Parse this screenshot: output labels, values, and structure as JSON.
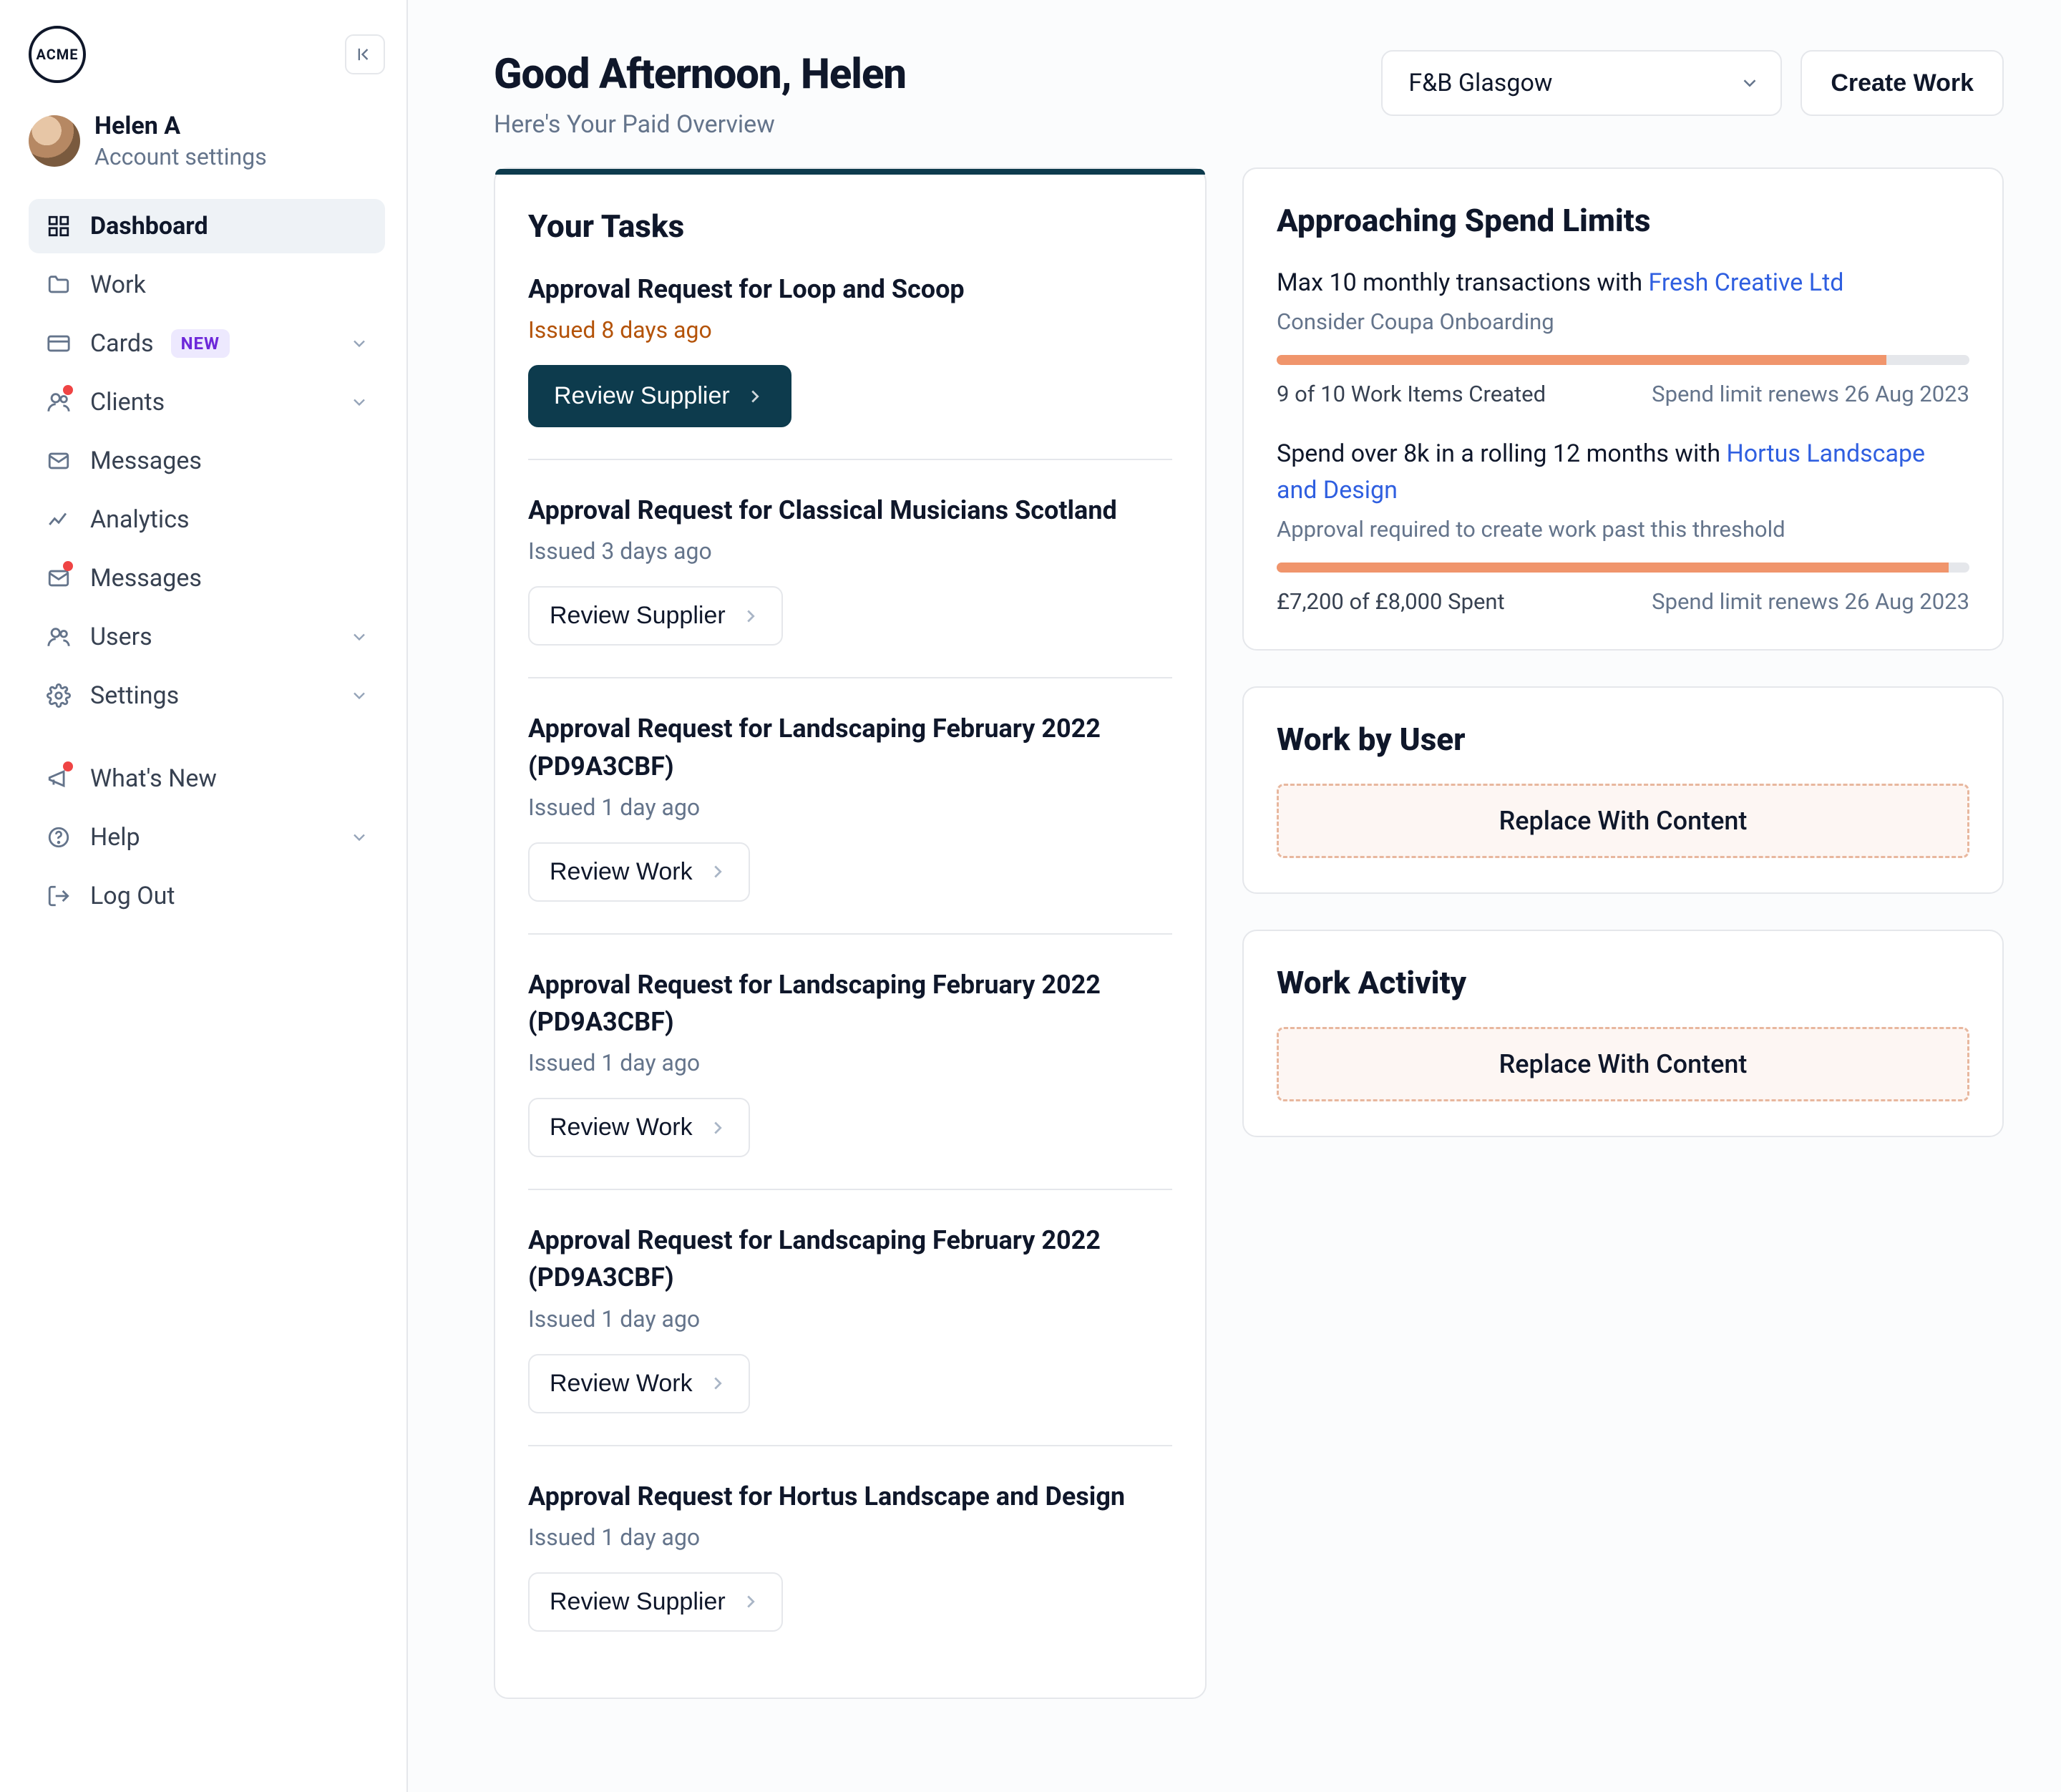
{
  "brand": "ACME",
  "user": {
    "name": "Helen A",
    "subtitle": "Account settings"
  },
  "sidebar": {
    "items": [
      {
        "label": "Dashboard"
      },
      {
        "label": "Work"
      },
      {
        "label": "Cards",
        "badge": "NEW"
      },
      {
        "label": "Clients"
      },
      {
        "label": "Messages"
      },
      {
        "label": "Analytics"
      },
      {
        "label": "Messages"
      },
      {
        "label": "Users"
      },
      {
        "label": "Settings"
      }
    ],
    "footer": [
      {
        "label": "What's New"
      },
      {
        "label": "Help"
      },
      {
        "label": "Log Out"
      }
    ]
  },
  "header": {
    "greeting": "Good Afternoon, Helen",
    "subtitle": "Here's Your Paid Overview",
    "select_value": "F&B Glasgow",
    "create_label": "Create Work"
  },
  "tasks": {
    "title": "Your Tasks",
    "items": [
      {
        "title": "Approval Request for Loop and Scoop",
        "meta": "Issued 8 days ago",
        "warn": true,
        "action": "Review Supplier",
        "primary": true
      },
      {
        "title": "Approval Request for Classical Musicians Scotland",
        "meta": "Issued 3 days ago",
        "warn": false,
        "action": "Review Supplier",
        "primary": false
      },
      {
        "title": "Approval Request for Landscaping February 2022 (PD9A3CBF)",
        "meta": "Issued 1 day ago",
        "warn": false,
        "action": "Review Work",
        "primary": false
      },
      {
        "title": "Approval Request for Landscaping February 2022 (PD9A3CBF)",
        "meta": "Issued 1 day ago",
        "warn": false,
        "action": "Review Work",
        "primary": false
      },
      {
        "title": "Approval Request for Landscaping February 2022 (PD9A3CBF)",
        "meta": "Issued 1 day ago",
        "warn": false,
        "action": "Review Work",
        "primary": false
      },
      {
        "title": "Approval Request for Hortus Landscape and Design",
        "meta": "Issued 1 day ago",
        "warn": false,
        "action": "Review Supplier",
        "primary": false
      }
    ]
  },
  "limits": {
    "title": "Approaching Spend Limits",
    "items": [
      {
        "text_before": "Max 10 monthly transactions with ",
        "link": "Fresh Creative Ltd",
        "subtitle": "Consider Coupa Onboarding",
        "progress_pct": 88,
        "footer_left": "9 of 10 Work Items Created",
        "footer_right": "Spend limit renews 26 Aug 2023"
      },
      {
        "text_before": "Spend over 8k in a rolling 12 months with ",
        "link": "Hortus Landscape and Design",
        "subtitle": "Approval required to create work past this threshold",
        "progress_pct": 97,
        "footer_left": "£7,200 of £8,000 Spent",
        "footer_right": "Spend limit renews 26 Aug 2023"
      }
    ]
  },
  "work_by_user": {
    "title": "Work by User",
    "placeholder": "Replace With Content"
  },
  "work_activity": {
    "title": "Work Activity",
    "placeholder": "Replace With Content"
  }
}
